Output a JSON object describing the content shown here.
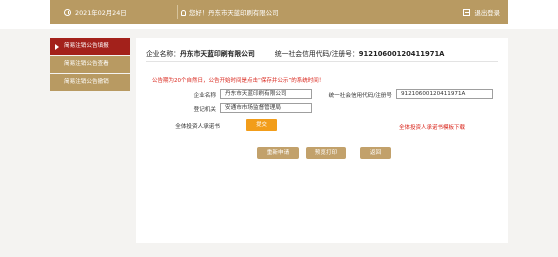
{
  "header": {
    "date": "2021年02月24日",
    "welcome": "您好！丹东市天蓝印刷有限公司",
    "logout": "退出登录"
  },
  "sidebar": {
    "items": [
      {
        "label": "简易注销公告填报",
        "active": true
      },
      {
        "label": "简易注销公告查看",
        "active": false
      },
      {
        "label": "简易注销公告撤销",
        "active": false
      }
    ]
  },
  "main": {
    "company_label": "企业名称：",
    "company_name": "丹东市天蓝印刷有限公司",
    "code_label": "统一社会信用代码/注册号：",
    "code_value": "91210600120411971A",
    "notice": "公告期为20个自然日，公告开始时间是点击“保存并公示”的系统时间！",
    "form": {
      "company_field_label": "企业名称",
      "company_field_value": "丹东市天蓝印刷有限公司",
      "code_field_label": "统一社会信用代码/注册号",
      "code_field_value": "91210600120411971A",
      "registry_label": "登记机关",
      "registry_value": "安通市市场监督管理局",
      "commitment_label": "全体投资人承诺书",
      "upload_label": "提交",
      "download_label": "全体投资人承诺书模板下载"
    },
    "buttons": {
      "reapply": "重新申请",
      "preview": "预览打印",
      "back": "返回"
    }
  },
  "colors": {
    "accent_gold": "#b89a62",
    "active_red": "#a3211b",
    "notice_red": "#d9241a",
    "upload_orange": "#f29d1a"
  }
}
